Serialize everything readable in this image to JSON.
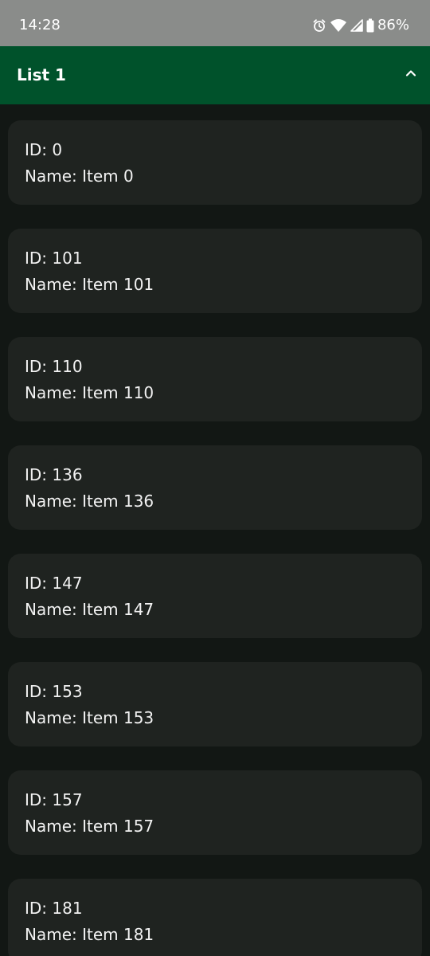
{
  "status_bar": {
    "time": "14:28",
    "battery": "86%",
    "icons": [
      "alarm-icon",
      "wifi-icon",
      "signal-icon",
      "battery-icon"
    ]
  },
  "header": {
    "title": "List 1",
    "toggle_icon": "chevron-up-icon"
  },
  "colors": {
    "status_bar": "#8a8c8a",
    "header": "#00522b",
    "background": "#121714",
    "card": "#1f2320",
    "text": "#f2f2f2"
  },
  "items": [
    {
      "id_text": "ID: 0",
      "name_text": "Name: Item 0"
    },
    {
      "id_text": "ID: 101",
      "name_text": "Name: Item 101"
    },
    {
      "id_text": "ID: 110",
      "name_text": "Name: Item 110"
    },
    {
      "id_text": "ID: 136",
      "name_text": "Name: Item 136"
    },
    {
      "id_text": "ID: 147",
      "name_text": "Name: Item 147"
    },
    {
      "id_text": "ID: 153",
      "name_text": "Name: Item 153"
    },
    {
      "id_text": "ID: 157",
      "name_text": "Name: Item 157"
    },
    {
      "id_text": "ID: 181",
      "name_text": "Name: Item 181"
    }
  ]
}
